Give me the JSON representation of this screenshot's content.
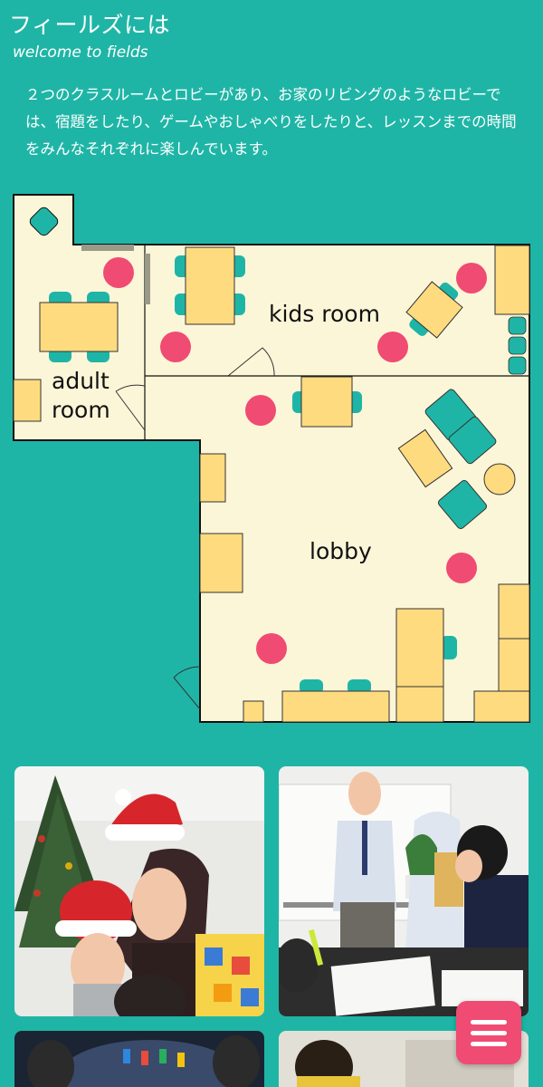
{
  "header": {
    "title": "フィールズには",
    "subtitle": "welcome to fields"
  },
  "intro": {
    "text": "２つのクラスルームとロビーがあり、お家のリビングのようなロビーでは、宿題をしたり、ゲームやおしゃべりをしたりと、レッスンまでの時間をみんなそれぞれに楽しんでいます。"
  },
  "floorplan": {
    "rooms": {
      "kids": "kids room",
      "adult_line1": "adult",
      "adult_line2": "room",
      "lobby": "lobby"
    },
    "colors": {
      "floor": "#fcf6d8",
      "table": "#ffdb80",
      "chair": "#1fb5a6",
      "dot": "#f04b72"
    }
  },
  "photos": [
    {
      "name": "christmas-lesson-photo"
    },
    {
      "name": "classroom-teacher-photo"
    },
    {
      "name": "board-game-photo"
    },
    {
      "name": "student-photo"
    }
  ],
  "menu": {
    "icon": "hamburger-icon",
    "color": "#f04b72"
  }
}
